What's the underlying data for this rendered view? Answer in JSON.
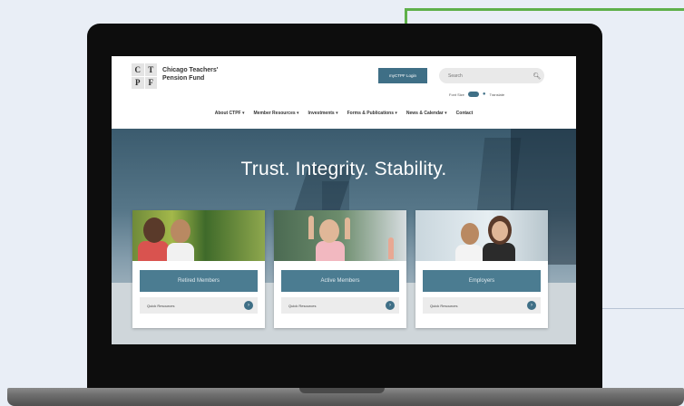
{
  "site": {
    "logo_letters": [
      "C",
      "T",
      "P",
      "F"
    ],
    "org_name": "Chicago Teachers' Pension Fund",
    "login_label": "myCTPF Login",
    "search_placeholder": "Search",
    "util_left": "Font Size",
    "util_right": "Translate",
    "nav": [
      "About CTPF ▾",
      "Member Resources ▾",
      "Investments ▾",
      "Forms & Publications ▾",
      "News & Calendar ▾",
      "Contact"
    ]
  },
  "hero": {
    "title": "Trust. Integrity. Stability."
  },
  "cards": [
    {
      "button": "Retired Members",
      "link": "Quick Resources"
    },
    {
      "button": "Active Members",
      "link": "Quick Resources"
    },
    {
      "button": "Employers",
      "link": "Quick Resources"
    }
  ],
  "icons": {
    "search": "search-icon",
    "arrow": "arrow-right-icon",
    "globe": "globe-icon"
  },
  "colors": {
    "accent": "#3f6f86",
    "card_button": "#4b7c91",
    "callout": "#5fb04a",
    "laptop": "#0d0d0d"
  }
}
